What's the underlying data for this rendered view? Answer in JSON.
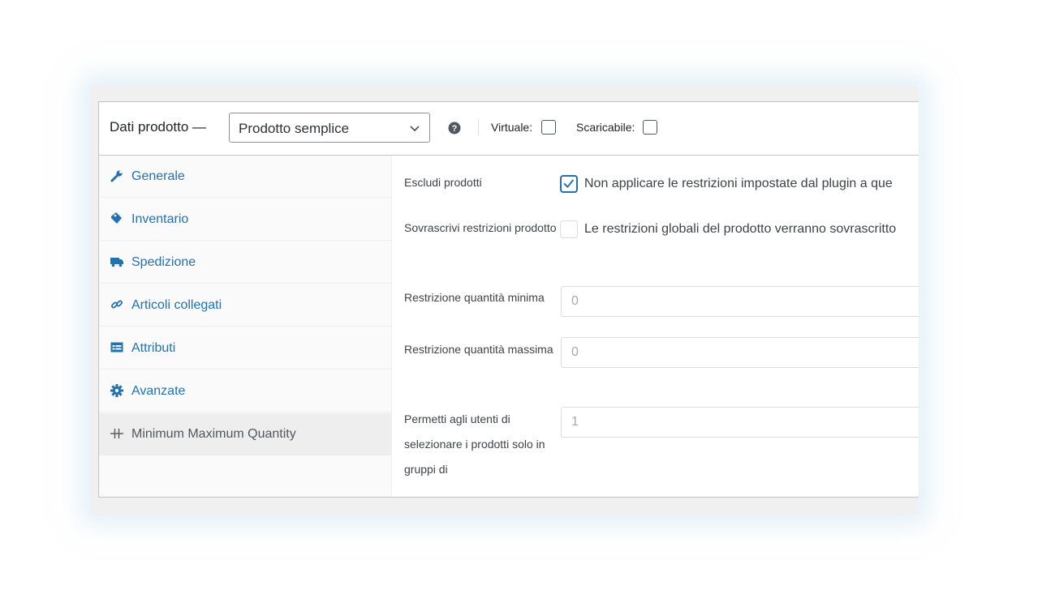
{
  "header": {
    "title": "Dati prodotto —",
    "product_type": {
      "selected": "Prodotto semplice"
    },
    "help_icon": "question-circle-icon",
    "virtual_label": "Virtuale:",
    "virtual_checked": false,
    "downloadable_label": "Scaricabile:",
    "downloadable_checked": false
  },
  "sidebar": {
    "items": [
      {
        "label": "Generale",
        "icon": "wrench-icon",
        "active": false
      },
      {
        "label": "Inventario",
        "icon": "tag-icon",
        "active": false
      },
      {
        "label": "Spedizione",
        "icon": "truck-icon",
        "active": false
      },
      {
        "label": "Articoli collegati",
        "icon": "link-icon",
        "active": false
      },
      {
        "label": "Attributi",
        "icon": "table-icon",
        "active": false
      },
      {
        "label": "Avanzate",
        "icon": "gear-icon",
        "active": false
      },
      {
        "label": "Minimum Maximum Quantity",
        "icon": "minmax-icon",
        "active": true
      }
    ]
  },
  "fields": {
    "exclude": {
      "label": "Escludi prodotti",
      "checked": true,
      "description": "Non applicare le restrizioni impostate dal plugin a que"
    },
    "override": {
      "label": "Sovrascrivi restrizioni prodotto",
      "checked": false,
      "description": "Le restrizioni globali del prodotto verranno sovrascritto"
    },
    "min_qty": {
      "label": "Restrizione quantità minima",
      "placeholder": "0"
    },
    "max_qty": {
      "label": "Restrizione quantità massima",
      "placeholder": "0"
    },
    "group_of": {
      "label": "Permetti agli utenti di selezionare i prodotti solo in gruppi di",
      "placeholder": "1"
    }
  },
  "colors": {
    "link": "#2271b1",
    "active_tab_bg": "#eeeeee",
    "border": "#c3c4c7"
  }
}
